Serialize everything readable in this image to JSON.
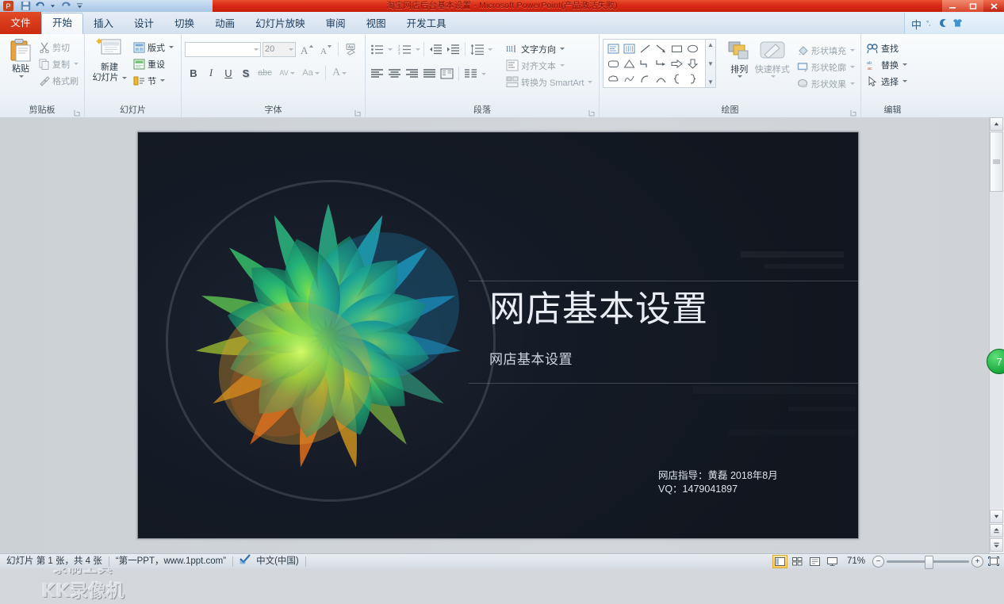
{
  "window": {
    "title": "淘宝网店后台基本设置 - Microsoft PowerPoint(产品激活失败)",
    "minimize": "—",
    "maximize": "❐",
    "close": "✕"
  },
  "quick_access": [
    "app-icon",
    "save-icon",
    "undo-icon",
    "redo-icon",
    "customize-icon"
  ],
  "tabs": [
    {
      "label": "文件",
      "name": "tab-file"
    },
    {
      "label": "开始",
      "name": "tab-home",
      "active": true
    },
    {
      "label": "插入",
      "name": "tab-insert"
    },
    {
      "label": "设计",
      "name": "tab-design"
    },
    {
      "label": "切换",
      "name": "tab-transitions"
    },
    {
      "label": "动画",
      "name": "tab-animations"
    },
    {
      "label": "幻灯片放映",
      "name": "tab-slideshow"
    },
    {
      "label": "审阅",
      "name": "tab-review"
    },
    {
      "label": "视图",
      "name": "tab-view"
    },
    {
      "label": "开发工具",
      "name": "tab-developer"
    }
  ],
  "language_bar": {
    "mode": "中",
    "items": [
      "pinyin-icon",
      "moon-icon",
      "shirt-icon"
    ]
  },
  "ribbon": {
    "clipboard": {
      "label": "剪贴板",
      "paste": "粘贴",
      "cut": "剪切",
      "copy": "复制",
      "format_painter": "格式刷"
    },
    "slides": {
      "label": "幻灯片",
      "new_slide": "新建\n幻灯片",
      "new_slide_line1": "新建",
      "new_slide_line2": "幻灯片",
      "layout": "版式",
      "reset": "重设",
      "section": "节"
    },
    "font": {
      "label": "字体",
      "font_name": "",
      "font_name_placeholder": "",
      "font_size": "20",
      "bold": "B",
      "italic": "I",
      "underline": "U",
      "shadow": "S",
      "strikethrough": "abc",
      "spacing": "AV",
      "case": "Aa",
      "color": "A",
      "clear_format": "clear-format-icon"
    },
    "paragraph": {
      "label": "段落",
      "text_direction": "文字方向",
      "align_text": "对齐文本",
      "convert_smartart": "转换为 SmartArt"
    },
    "drawing": {
      "label": "绘图",
      "arrange": "排列",
      "quick_styles": "快速样式",
      "shape_fill": "形状填充",
      "shape_outline": "形状轮廓",
      "shape_effects": "形状效果"
    },
    "editing": {
      "label": "编辑",
      "find": "查找",
      "replace": "替换",
      "select": "选择"
    }
  },
  "slide": {
    "title": "网店基本设置",
    "subtitle": "网店基本设置",
    "footer_line1": "网店指导：黄磊  2018年8月",
    "footer_line2": "VQ：1479041897",
    "background_color": "#141a24"
  },
  "watermark": {
    "line1": "录制工具",
    "line2": "KK录像机"
  },
  "status_bar": {
    "slide_count": "幻灯片 第 1 张，共 4 张",
    "theme": "“第一PPT，www.1ppt.com”",
    "proofing_icon": "spellcheck-icon",
    "language": "中文(中国)",
    "zoom_level": "71%",
    "zoom_out": "−",
    "zoom_in": "+",
    "views": [
      "normal-view-icon",
      "slide-sorter-icon",
      "reading-view-icon",
      "slideshow-icon"
    ],
    "fit_window": "fit-slide-icon"
  },
  "side_badge": {
    "label": "7"
  },
  "colors": {
    "title_bar_red": "#cc2a10",
    "accent_blue": "#2a6099",
    "slide_dark": "#141a24",
    "green_badge": "#16a83a"
  }
}
